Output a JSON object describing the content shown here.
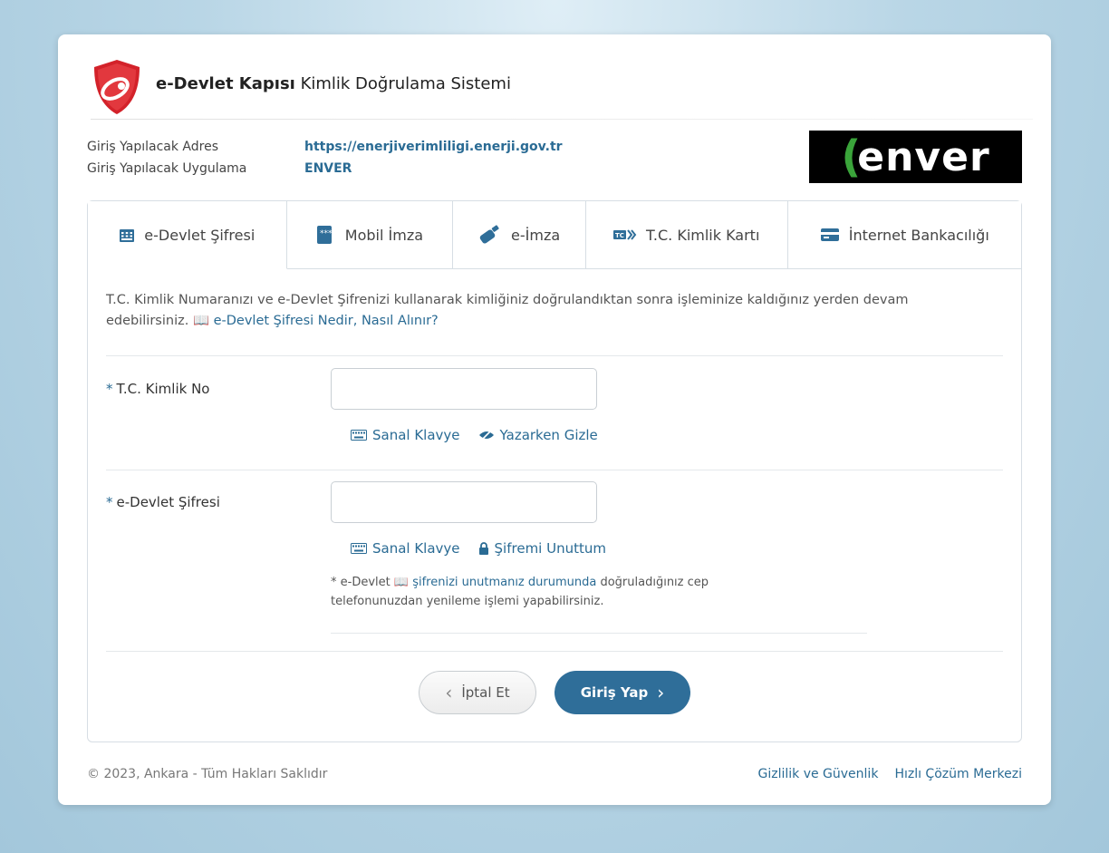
{
  "header": {
    "brand_bold": "e-Devlet Kapısı",
    "brand_rest": " Kimlik Doğrulama Sistemi"
  },
  "info": {
    "address_label": "Giriş Yapılacak Adres",
    "address_value": "https://enerjiverimliligi.enerji.gov.tr",
    "app_label": "Giriş Yapılacak Uygulama",
    "app_value": "ENVER"
  },
  "partner_logo": {
    "text": "enver",
    "leaf": "("
  },
  "tabs": [
    {
      "label": "e-Devlet Şifresi",
      "icon": "keypad-icon",
      "active": true
    },
    {
      "label": "Mobil İmza",
      "icon": "mobile-signature-icon"
    },
    {
      "label": "e-İmza",
      "icon": "usb-token-icon"
    },
    {
      "label": "T.C. Kimlik Kartı",
      "icon": "id-card-icon",
      "icon_text": "TC"
    },
    {
      "label": "İnternet Bankacılığı",
      "icon": "bank-card-icon"
    }
  ],
  "intro": {
    "text": "T.C. Kimlik Numaranızı ve e-Devlet Şifrenizi kullanarak kimliğiniz doğrulandıktan sonra işleminize kaldığınız yerden devam edebilirsiniz.",
    "link": "e-Devlet Şifresi Nedir, Nasıl Alınır?"
  },
  "form": {
    "required_mark": "*",
    "tc_label": "T.C. Kimlik No",
    "tc_value": "",
    "password_label": "e-Devlet Şifresi",
    "password_value": "",
    "virtual_keyboard": "Sanal Klavye",
    "hide_while_typing": "Yazarken Gizle",
    "forgot_password": "Şifremi Unuttum",
    "note_prefix": "* e-Devlet",
    "note_link": "şifrenizi unutmanız durumunda",
    "note_suffix": "doğruladığınız cep telefonunuzdan yenileme işlemi yapabilirsiniz."
  },
  "buttons": {
    "cancel": "İptal Et",
    "login": "Giriş Yap"
  },
  "footer": {
    "copyright": "© 2023, Ankara - Tüm Hakları Saklıdır",
    "privacy": "Gizlilik ve Güvenlik",
    "help": "Hızlı Çözüm Merkezi"
  },
  "colors": {
    "accent": "#2f6e99",
    "link": "#2a6b94",
    "logo_red": "#d3222a"
  }
}
